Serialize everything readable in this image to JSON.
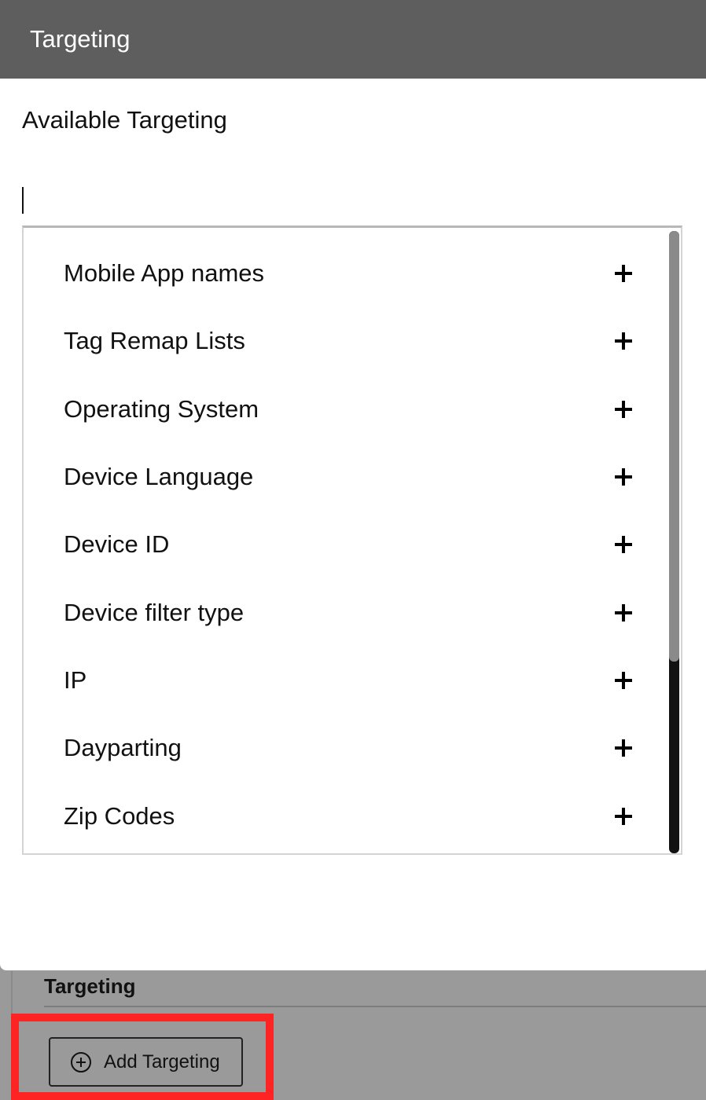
{
  "modal": {
    "title": "Targeting",
    "available_label": "Available Targeting",
    "search": {
      "value": "",
      "placeholder": ""
    },
    "items": [
      {
        "label": "Mobile App names",
        "icon": "plus-icon"
      },
      {
        "label": "Tag Remap Lists",
        "icon": "plus-icon"
      },
      {
        "label": "Operating System",
        "icon": "plus-icon"
      },
      {
        "label": "Device Language",
        "icon": "plus-icon"
      },
      {
        "label": "Device ID",
        "icon": "plus-icon"
      },
      {
        "label": "Device filter type",
        "icon": "plus-icon"
      },
      {
        "label": "IP",
        "icon": "plus-icon"
      },
      {
        "label": "Dayparting",
        "icon": "plus-icon"
      },
      {
        "label": "Zip Codes",
        "icon": "plus-icon"
      }
    ]
  },
  "background": {
    "section_title": "Targeting",
    "add_button_label": "Add Targeting",
    "add_button_icon": "plus-circle-icon",
    "highlight_color": "#ff2424"
  },
  "colors": {
    "header_bg": "#5e5e5e",
    "overlay_bg": "#9a9a9a"
  }
}
